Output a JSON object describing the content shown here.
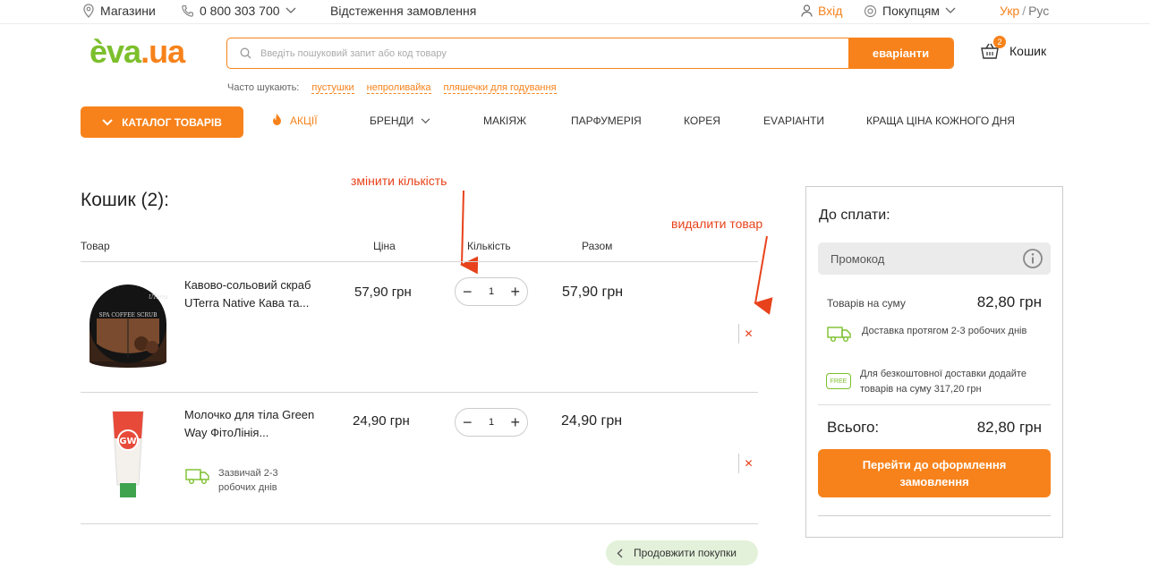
{
  "topbar": {
    "stores": "Магазини",
    "phone": "0 800 303 700",
    "tracking": "Відстеження замовлення",
    "login": "Вхід",
    "customers": "Покупцям",
    "lang_active": "Укр",
    "lang_sep": "/",
    "lang_other": "Рус"
  },
  "header": {
    "logo_left": "èva",
    "logo_right": ".ua",
    "search_placeholder": "Введіть пошуковий запит або код товару",
    "search_button": "еваріанти",
    "cart_label": "Кошик",
    "cart_count": "2"
  },
  "frequent": {
    "label": "Часто шукають:",
    "items": [
      "пустушки",
      "непроливайка",
      "пляшечки для годування"
    ]
  },
  "nav": {
    "catalog": "КАТАЛОГ ТОВАРІВ",
    "items": [
      "АКЦІЇ",
      "БРЕНДИ",
      "МАКІЯЖ",
      "ПАРФУМЕРІЯ",
      "КОРЕЯ",
      "EVАРІАНТИ",
      "КРАЩА ЦІНА КОЖНОГО ДНЯ"
    ]
  },
  "cart": {
    "title": "Кошик (2):",
    "annotation_qty": "змінити кількість",
    "annotation_delete": "видалити товар",
    "headers": {
      "product": "Товар",
      "price": "Ціна",
      "quantity": "Кількість",
      "total": "Разом"
    },
    "items": [
      {
        "name": "Кавово-сольовий скраб UTerra Native Кава та...",
        "price": "57,90 грн",
        "qty": "1",
        "total": "57,90 грн",
        "delivery": "",
        "img_label": "SPA COFFEE SCRUB"
      },
      {
        "name": "Молочко для тіла Green Way ФітоЛінія...",
        "price": "24,90 грн",
        "qty": "1",
        "total": "24,90 грн",
        "delivery": "Зазвичай 2-3 робочих днів",
        "img_label": "GW"
      }
    ],
    "continue": "Продовжити покупки"
  },
  "summary": {
    "title": "До сплати:",
    "promo_placeholder": "Промокод",
    "goods_sum_label": "Товарів на суму",
    "goods_sum_value": "82,80 грн",
    "delivery_text": "Доставка протягом 2-3 робочих днів",
    "free_badge": "FREE",
    "free_text": "Для безкоштовної доставки додайте товарів на суму 317,20 грн",
    "total_label": "Всього:",
    "total_value": "82,80 грн",
    "checkout": "Перейти до оформлення замовлення"
  },
  "colors": {
    "accent": "#f7821b",
    "green": "#7cbf2c",
    "annotation": "#e7421b"
  }
}
